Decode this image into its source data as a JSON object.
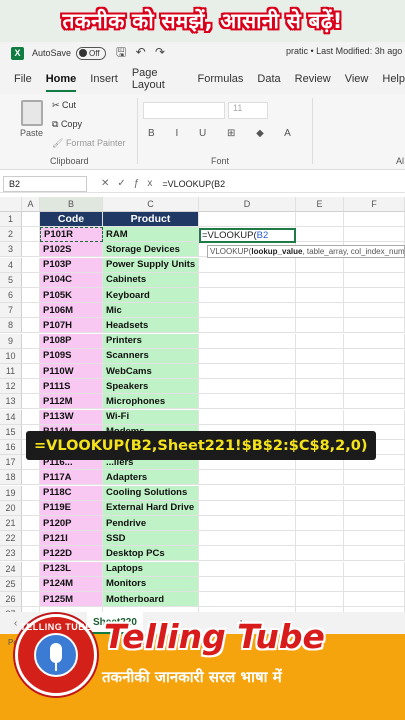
{
  "banner": {
    "text": "तकनीक को समझें, आसानी से बढ़ें!"
  },
  "titlebar": {
    "logo": "X",
    "autosave": "AutoSave",
    "toggle": "Off",
    "file_info": "pratic • Last Modified: 3h ago"
  },
  "menu": [
    "File",
    "Home",
    "Insert",
    "Page Layout",
    "Formulas",
    "Data",
    "Review",
    "View",
    "Help"
  ],
  "ribbon": {
    "paste": "Paste",
    "cut": "Cut",
    "copy": "Copy",
    "format_painter": "Format Painter",
    "clipboard": "Clipboard",
    "font_size": "11",
    "font_group": "Font",
    "alignment_group": "Al"
  },
  "formula_bar": {
    "name_box": "B2",
    "value": "=VLOOKUP(B2"
  },
  "columns": [
    "A",
    "B",
    "C",
    "D",
    "E",
    "F"
  ],
  "headers": {
    "code": "Code",
    "product": "Product"
  },
  "rows": [
    {
      "n": "1",
      "code": "",
      "product": ""
    },
    {
      "n": "2",
      "code": "P101R",
      "product": "RAM"
    },
    {
      "n": "3",
      "code": "P102S",
      "product": "Storage Devices"
    },
    {
      "n": "4",
      "code": "P103P",
      "product": "Power Supply Units"
    },
    {
      "n": "5",
      "code": "P104C",
      "product": "Cabinets"
    },
    {
      "n": "6",
      "code": "P105K",
      "product": "Keyboard"
    },
    {
      "n": "7",
      "code": "P106M",
      "product": "Mic"
    },
    {
      "n": "8",
      "code": "P107H",
      "product": "Headsets"
    },
    {
      "n": "9",
      "code": "P108P",
      "product": "Printers"
    },
    {
      "n": "10",
      "code": "P109S",
      "product": "Scanners"
    },
    {
      "n": "11",
      "code": "P110W",
      "product": "WebCams"
    },
    {
      "n": "12",
      "code": "P111S",
      "product": "Speakers"
    },
    {
      "n": "13",
      "code": "P112M",
      "product": "Microphones"
    },
    {
      "n": "14",
      "code": "P113W",
      "product": "Wi-Fi"
    },
    {
      "n": "15",
      "code": "P114M",
      "product": "Modems"
    },
    {
      "n": "16",
      "code": "",
      "product": ""
    },
    {
      "n": "17",
      "code": "P116...",
      "product": "...llers"
    },
    {
      "n": "18",
      "code": "P117A",
      "product": "Adapters"
    },
    {
      "n": "19",
      "code": "P118C",
      "product": "Cooling Solutions"
    },
    {
      "n": "20",
      "code": "P119E",
      "product": "External Hard Drive"
    },
    {
      "n": "21",
      "code": "P120P",
      "product": "Pendrive"
    },
    {
      "n": "22",
      "code": "P121I",
      "product": "SSD"
    },
    {
      "n": "23",
      "code": "P122D",
      "product": "Desktop PCs"
    },
    {
      "n": "24",
      "code": "P123L",
      "product": "Laptops"
    },
    {
      "n": "25",
      "code": "P124M",
      "product": "Monitors"
    },
    {
      "n": "26",
      "code": "P125M",
      "product": "Motherboard"
    },
    {
      "n": "27",
      "code": "",
      "product": ""
    }
  ],
  "edit_cell": {
    "prefix": "=VLOOKUP(",
    "ref": "B2"
  },
  "tooltip": {
    "fn": "VLOOKUP(",
    "arg1": "lookup_value",
    "rest": ", table_array, col_index_num"
  },
  "formula_overlay": "=VLOOKUP(B2,Sheet221!$B$2:$C$8,2,0)",
  "sheet_tab": "Sheet220",
  "status": "Point",
  "logo_text": "TELLING TUBE",
  "brand": "Telling Tube",
  "tagline": "तकनीकी जानकारी सरल भाषा में",
  "colors": {
    "excel_green": "#107c41",
    "code_fill": "#f8c7f2",
    "product_fill": "#bff2c6",
    "header_fill": "#1f3864",
    "footer": "#f5a40e",
    "brand_red": "#d81b1b"
  }
}
